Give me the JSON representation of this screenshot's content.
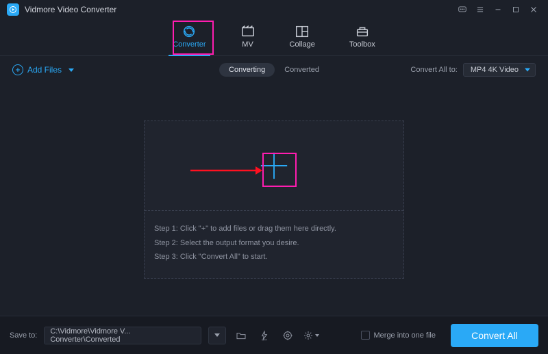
{
  "app": {
    "title": "Vidmore Video Converter"
  },
  "tabs": {
    "converter": "Converter",
    "mv": "MV",
    "collage": "Collage",
    "toolbox": "Toolbox"
  },
  "toolbar": {
    "add_files": "Add Files",
    "converting": "Converting",
    "converted": "Converted",
    "convert_all_to": "Convert All to:",
    "format": "MP4 4K Video"
  },
  "steps": {
    "s1": "Step 1: Click \"+\" to add files or drag them here directly.",
    "s2": "Step 2: Select the output format you desire.",
    "s3": "Step 3: Click \"Convert All\" to start."
  },
  "bottom": {
    "save_to": "Save to:",
    "path": "C:\\Vidmore\\Vidmore V... Converter\\Converted",
    "merge": "Merge into one file",
    "convert": "Convert All"
  }
}
